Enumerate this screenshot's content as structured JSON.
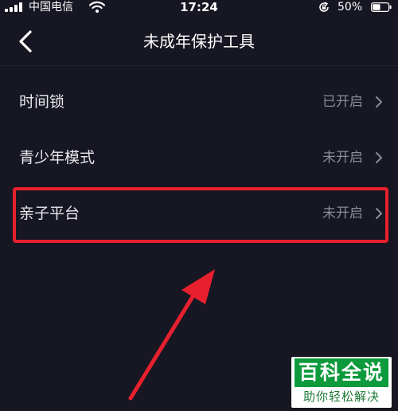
{
  "status_bar": {
    "carrier": "中国电信",
    "time": "17:24",
    "battery": "50%",
    "icons": [
      "signal-icon",
      "wifi-icon",
      "rotation-lock-icon",
      "battery-icon"
    ]
  },
  "nav": {
    "title": "未成年保护工具",
    "back_icon": "chevron-left-icon"
  },
  "settings": [
    {
      "label": "时间锁",
      "status": "已开启"
    },
    {
      "label": "青少年模式",
      "status": "未开启"
    },
    {
      "label": "亲子平台",
      "status": "未开启"
    }
  ],
  "annotation": {
    "highlight_color": "#e8202e",
    "highlighted_item": "亲子平台"
  },
  "watermark": {
    "main": "百科全说",
    "sub": "助你轻松解决"
  },
  "colors": {
    "background": "#161722",
    "text_primary": "#e8e8ec",
    "text_secondary": "#8a8b94",
    "watermark_green": "#0c9a3c"
  }
}
